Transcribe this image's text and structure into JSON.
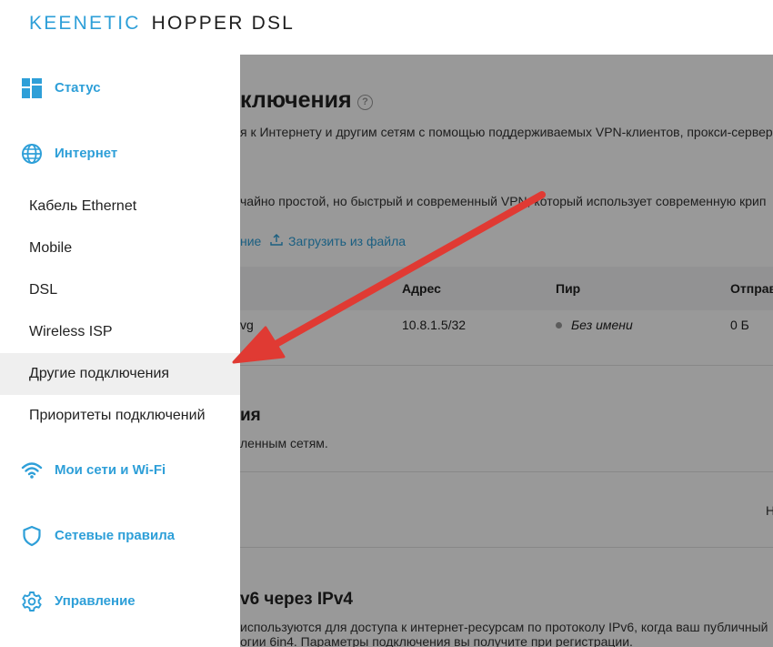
{
  "header": {
    "brand": "KEENETIC",
    "model": "HOPPER DSL"
  },
  "main": {
    "title": "ключения",
    "desc1": "я к Интернету и другим сетям с помощью поддерживаемых VPN-клиентов, прокси-сервер",
    "desc2": "чайно простой, но быстрый и современный VPN, который использует современную крип",
    "link_create": "ние",
    "link_upload": "Загрузить из файла",
    "table": {
      "headers": [
        "Адрес",
        "Пир",
        "Отправ"
      ],
      "row": {
        "name": "vg",
        "address": "10.8.1.5/32",
        "peer": "Без имени",
        "sent": "0 Б"
      }
    },
    "section2_title": "ия",
    "section2_desc": "ленным сетям.",
    "section2_cell": "Н",
    "section3_title": "v6 через IPv4",
    "section3_desc1": "используются для доступа к интернет-ресурсам по протоколу IPv6, когда ваш публичный",
    "section3_desc2": "огии 6in4. Параметры подключения вы получите при регистрации."
  },
  "sidebar": {
    "groups": [
      {
        "label": "Статус",
        "icon": "dashboard-icon"
      },
      {
        "label": "Интернет",
        "icon": "globe-icon"
      },
      {
        "label": "Мои сети и Wi-Fi",
        "icon": "wifi-icon"
      },
      {
        "label": "Сетевые правила",
        "icon": "shield-icon"
      },
      {
        "label": "Управление",
        "icon": "gear-icon"
      }
    ],
    "items": [
      {
        "label": "Кабель Ethernet"
      },
      {
        "label": "Mobile"
      },
      {
        "label": "DSL"
      },
      {
        "label": "Wireless ISP"
      },
      {
        "label": "Другие подключения"
      },
      {
        "label": "Приоритеты подключений"
      }
    ]
  },
  "colors": {
    "accent": "#2e9fd8",
    "arrow": "#e03a33",
    "active_bg": "#efefef"
  }
}
